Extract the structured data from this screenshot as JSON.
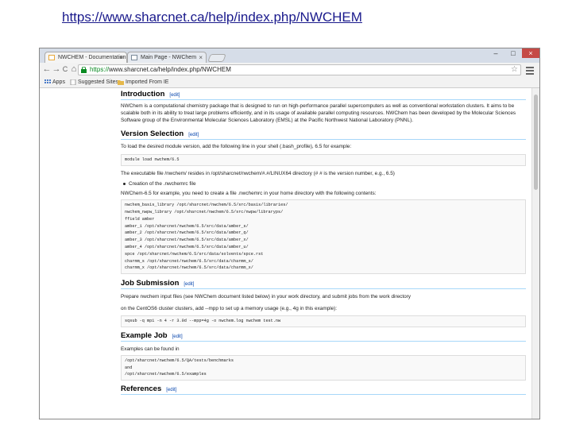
{
  "slide_url": "https://www.sharcnet.ca/help/index.php/NWCHEM",
  "browser": {
    "tabs": [
      {
        "label": "NWCHEM - Documentation",
        "active": true
      },
      {
        "label": "Main Page - NWChem",
        "active": false
      }
    ],
    "tab_close_glyph": "×",
    "window_controls": [
      "–",
      "□",
      "×"
    ],
    "nav_icons": [
      "back-icon",
      "forward-icon",
      "reload-icon",
      "home-icon"
    ],
    "nav_glyphs": [
      "←",
      "→",
      "C",
      "⌂"
    ],
    "address": {
      "scheme": "https://",
      "rest": "www.sharcnet.ca/help/index.php/NWCHEM"
    },
    "star_glyph": "☆",
    "bookmarks": [
      "Apps",
      "Suggested Sites",
      "Imported From IE"
    ],
    "colors": {
      "https_green": "#0a8a22",
      "link_blue": "#0645ad",
      "close_red": "#c54a46"
    }
  },
  "article": {
    "edit_label": "[edit]",
    "introduction": {
      "heading": "Introduction",
      "text": "NWChem is a computational chemistry package that is designed to run on high-performance parallel supercomputers as well as conventional workstation clusters. It aims to be scalable both in its ability to treat large problems efficiently, and in its usage of available parallel computing resources. NWChem has been developed by the Molecular Sciences Software group of the Environmental Molecular Sciences Laboratory (EMSL) at the Pacific Northwest National Laboratory (PNNL)."
    },
    "version_selection": {
      "heading": "Version Selection",
      "intro": "To load the desired module version, add the following line in your shell (.bash_profile), 6.5 for example:",
      "code": "module load nwchem/6.5",
      "text2": "The executable file /nwchem/ resides in /opt/sharcnet/nwchem/#.#/LINUX64 directory (# # is the version number, e.g., 6.5)",
      "bullet": "Creation of the .nwchemrc file",
      "text3": "NWChem-6.5 for example, you need to create a file .nwchemrc in your home directory with the following contents:",
      "code_block": "nwchem_basis_library /opt/sharcnet/nwchem/6.5/src/basis/libraries/\nnwchem_nwpw_library /opt/sharcnet/nwchem/6.5/src/nwpw/libraryps/\nffield amber\namber_1 /opt/sharcnet/nwchem/6.5/src/data/amber_s/\namber_2 /opt/sharcnet/nwchem/6.5/src/data/amber_q/\namber_3 /opt/sharcnet/nwchem/6.5/src/data/amber_x/\namber_4 /opt/sharcnet/nwchem/6.5/src/data/amber_u/\nspce /opt/sharcnet/nwchem/6.5/src/data/solvents/spce.rst\ncharmm_s /opt/sharcnet/nwchem/6.5/src/data/charmm_s/\ncharmm_x /opt/sharcnet/nwchem/6.5/src/data/charmm_x/"
    },
    "job_submission": {
      "heading": "Job Submission",
      "text1": "Prepare nwchem input files (see NWChem document listed below) in your work directory, and submit jobs from the work directory",
      "text2": "on the CentOS6 cluster clusters, add --mpp to set up a memory usage (e.g., 4g in this example):",
      "code": "sqsub -q mpi -n 4 -r 3.0d --mpp=4g -o nwchem.log nwchem test.nw"
    },
    "example_job": {
      "heading": "Example Job",
      "text": "Examples can be found in",
      "code": "/opt/sharcnet/nwchem/6.5/QA/tests/benchmarks\nand\n/opt/sharcnet/nwchem/6.5/examples"
    },
    "references": {
      "heading": "References"
    }
  }
}
